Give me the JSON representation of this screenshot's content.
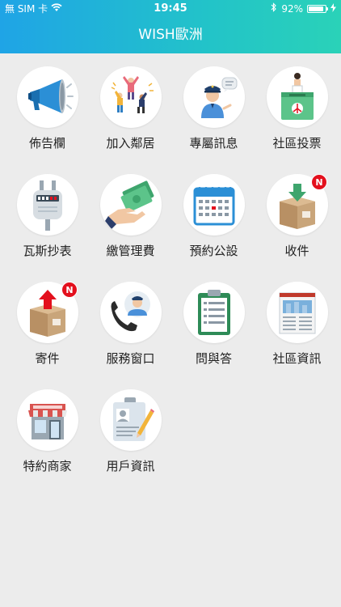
{
  "status_bar": {
    "carrier": "無 SIM 卡",
    "time": "19:45",
    "battery_pct": "92%",
    "battery_level": 0.92,
    "icons": [
      "wifi-icon",
      "bluetooth-icon",
      "battery-icon",
      "charging-icon"
    ]
  },
  "header": {
    "title": "WISH歐洲",
    "gradient": [
      "#1fa4e6",
      "#2ad2b8"
    ]
  },
  "tiles": [
    {
      "label": "佈告欄",
      "icon": "megaphone-icon"
    },
    {
      "label": "加入鄰居",
      "icon": "neighbors-icon"
    },
    {
      "label": "專屬訊息",
      "icon": "guard-message-icon"
    },
    {
      "label": "社區投票",
      "icon": "ballot-box-icon"
    },
    {
      "label": "瓦斯抄表",
      "icon": "gas-meter-icon"
    },
    {
      "label": "繳管理費",
      "icon": "cash-payment-icon"
    },
    {
      "label": "預約公設",
      "icon": "calendar-icon"
    },
    {
      "label": "收件",
      "icon": "package-receive-icon",
      "badge": "N"
    },
    {
      "label": "寄件",
      "icon": "package-send-icon",
      "badge": "N"
    },
    {
      "label": "服務窗口",
      "icon": "service-phone-icon"
    },
    {
      "label": "問與答",
      "icon": "faq-clipboard-icon"
    },
    {
      "label": "社區資訊",
      "icon": "newspaper-icon"
    },
    {
      "label": "特約商家",
      "icon": "store-icon"
    },
    {
      "label": "用戶資訊",
      "icon": "user-card-icon"
    }
  ],
  "colors": {
    "badge": "#e3101d",
    "background": "#ececec"
  }
}
